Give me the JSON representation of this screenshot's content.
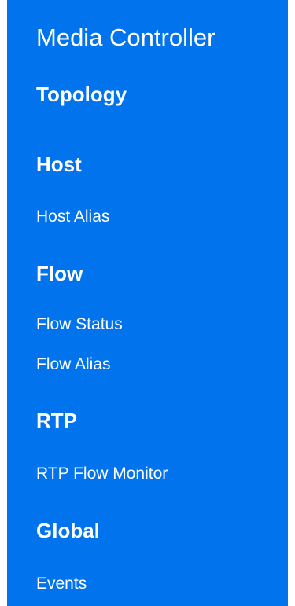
{
  "app": {
    "title": "Media Controller"
  },
  "theme": {
    "sidebar_background": "#0174ED",
    "text_color": "#FFFFFF"
  },
  "nav": {
    "topology": "Topology",
    "host": {
      "heading": "Host",
      "items": [
        "Host Alias"
      ]
    },
    "flow": {
      "heading": "Flow",
      "items": [
        "Flow Status",
        "Flow Alias"
      ]
    },
    "rtp": {
      "heading": "RTP",
      "items": [
        "RTP Flow Monitor"
      ]
    },
    "global": {
      "heading": "Global",
      "items": [
        "Events"
      ]
    }
  }
}
